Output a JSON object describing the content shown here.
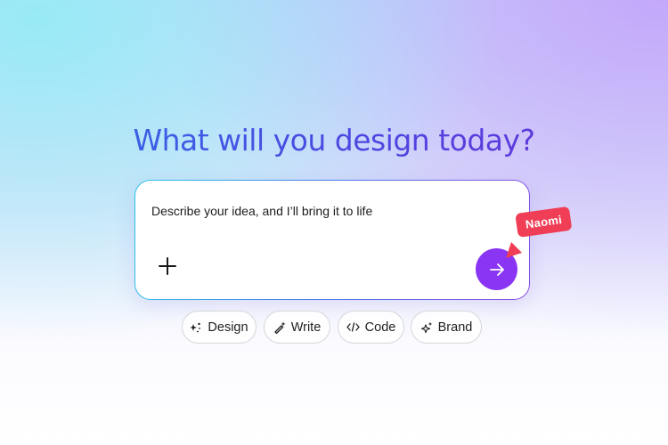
{
  "headline": "What will you design today?",
  "prompt": {
    "placeholder": "Describe your idea, and I’ll bring it to life",
    "value": ""
  },
  "collaborator": {
    "name": "Naomi",
    "color": "#ef3e55"
  },
  "chips": [
    {
      "label": "Design",
      "icon": "sparkle-dots-icon"
    },
    {
      "label": "Write",
      "icon": "magic-pen-icon"
    },
    {
      "label": "Code",
      "icon": "code-brackets-icon"
    },
    {
      "label": "Brand",
      "icon": "sparkles-icon"
    }
  ],
  "colors": {
    "accent": "#8a35f3",
    "headline_start": "#2f6fe8",
    "headline_end": "#6a32d9",
    "cursor": "#ef3e55"
  }
}
